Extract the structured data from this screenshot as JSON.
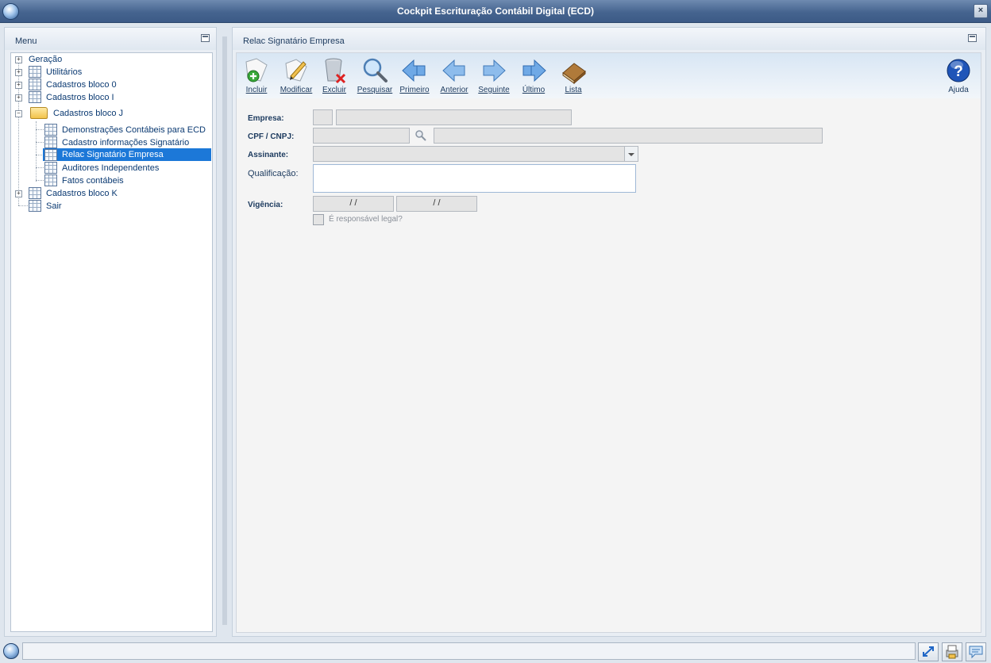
{
  "window": {
    "title": "Cockpit Escrituração Contábil Digital (ECD)",
    "close_glyph": "×"
  },
  "menu_panel": {
    "title": "Menu"
  },
  "tree": {
    "items": [
      {
        "label": "Geração"
      },
      {
        "label": "Utilitários"
      },
      {
        "label": "Cadastros bloco 0"
      },
      {
        "label": "Cadastros bloco I"
      },
      {
        "label": "Cadastros bloco J"
      },
      {
        "label": "Demonstrações Contábeis para ECD"
      },
      {
        "label": "Cadastro informações Signatário"
      },
      {
        "label": "Relac Signatário Empresa"
      },
      {
        "label": "Auditores Independentes"
      },
      {
        "label": "Fatos contábeis"
      },
      {
        "label": "Cadastros bloco K"
      },
      {
        "label": "Sair"
      }
    ]
  },
  "content_panel": {
    "title": "Relac Signatário Empresa"
  },
  "toolbar": {
    "incluir": "Incluir",
    "modificar": "Modificar",
    "excluir": "Excluir",
    "pesquisar": "Pesquisar",
    "primeiro": "Primeiro",
    "anterior": "Anterior",
    "seguinte": "Seguinte",
    "ultimo": "Último",
    "lista": "Lista",
    "ajuda": "Ajuda"
  },
  "form": {
    "empresa_label": "Empresa:",
    "cpf_label": "CPF / CNPJ:",
    "assinante_label": "Assinante:",
    "qualificacao_label": "Qualificação:",
    "vigencia_label": "Vigência:",
    "vigencia_inicio": "/ /",
    "vigencia_fim": "/ /",
    "responsavel_label": "É responsável legal?"
  },
  "colors": {
    "accent": "#1c78d8",
    "title_bar": "#45648f",
    "help": "#1f55b8"
  }
}
